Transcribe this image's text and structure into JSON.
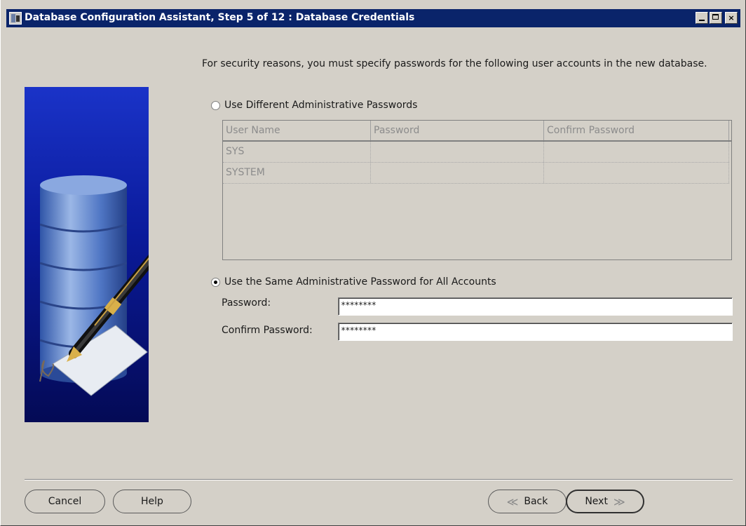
{
  "window": {
    "title": "Database Configuration Assistant, Step 5 of 12 : Database Credentials",
    "controls": {
      "minimize": "",
      "maximize": "",
      "close": "×"
    }
  },
  "main": {
    "intro_text": "For security reasons, you must specify passwords for the following user accounts in the new database.",
    "option_different": {
      "label": "Use Different Administrative Passwords",
      "selected": false
    },
    "table": {
      "columns": [
        "User Name",
        "Password",
        "Confirm Password"
      ],
      "rows": [
        {
          "user_name": "SYS",
          "password": "",
          "confirm_password": ""
        },
        {
          "user_name": "SYSTEM",
          "password": "",
          "confirm_password": ""
        }
      ]
    },
    "option_same": {
      "label": "Use the Same Administrative Password for All Accounts",
      "selected": true
    },
    "password": {
      "label": "Password:",
      "value": "********"
    },
    "confirm_password": {
      "label": "Confirm Password:",
      "value": "********"
    }
  },
  "footer": {
    "cancel_label": "Cancel",
    "help_label": "Help",
    "back_label": "Back",
    "next_label": "Next",
    "back_arrow": "≪",
    "next_arrow": "≫"
  },
  "colors": {
    "titlebar": "#0a246a",
    "panel_top": "#1a33c8",
    "panel_bottom": "#040a55",
    "dialog_bg": "#d4d0c8"
  }
}
